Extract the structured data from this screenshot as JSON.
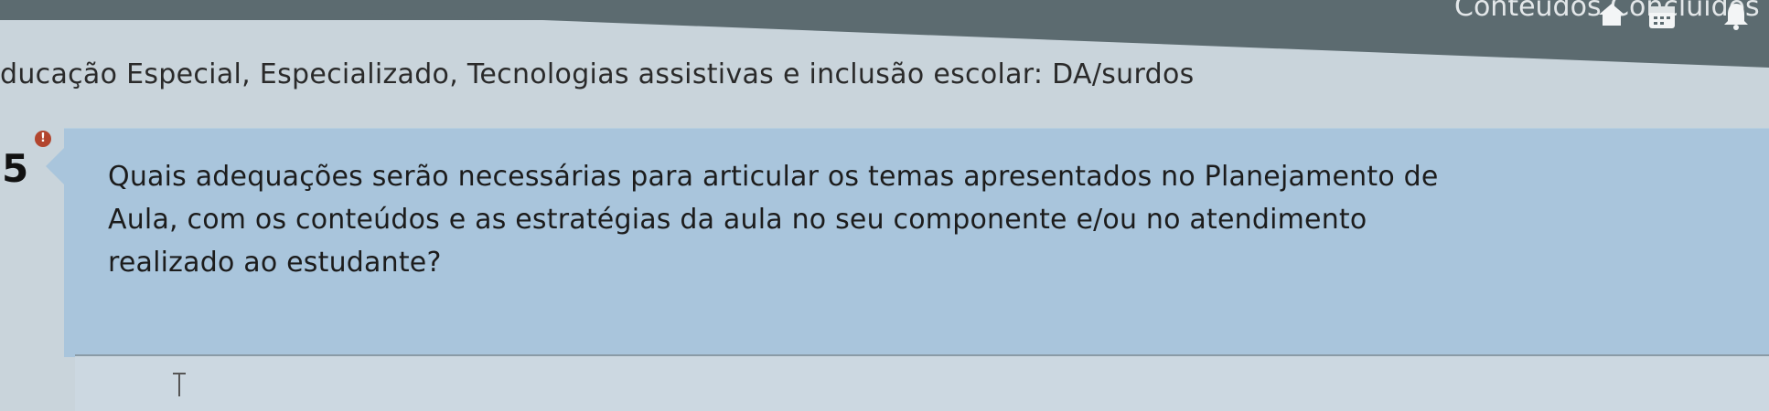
{
  "header": {
    "status": "Conteúdos Concluídos",
    "icons": [
      "home-icon",
      "calendar-icon",
      "bell-icon"
    ]
  },
  "subtitle": "ducação Especial, Especializado, Tecnologias assistivas e inclusão escolar: DA/surdos",
  "question": {
    "number": "5",
    "alert": "!",
    "lines": [
      "Quais adequações serão necessárias para articular os temas apresentados no Planejamento de",
      "Aula, com os conteúdos e as estratégias da aula no seu componente e/ou no atendimento",
      "realizado ao estudante?"
    ]
  },
  "colors": {
    "card": "#a9c5dc",
    "page": "#c9d4db",
    "topbar": "#5c6b70",
    "alert": "#b2452e"
  }
}
